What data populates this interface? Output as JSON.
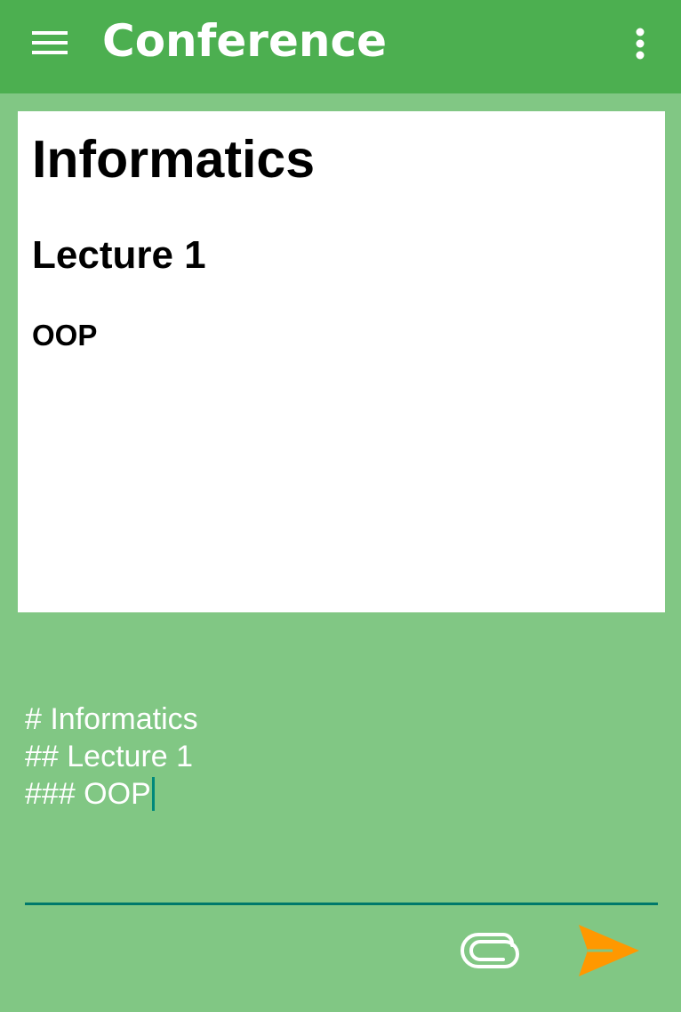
{
  "app_bar": {
    "title": "Conference",
    "menu_icon": "menu-icon",
    "overflow_icon": "more-vert-icon",
    "background": "#4caf50"
  },
  "preview": {
    "heading1": "Informatics",
    "heading2": "Lecture 1",
    "heading3": "OOP"
  },
  "editor": {
    "lines": [
      "# Informatics",
      "## Lecture 1",
      "### OOP"
    ],
    "cursor_color": "#00897b"
  },
  "actions": {
    "attach_icon": "paperclip-icon",
    "send_icon": "send-icon",
    "send_color": "#ff9800"
  },
  "colors": {
    "page_background": "#81c784",
    "card_background": "#ffffff"
  }
}
